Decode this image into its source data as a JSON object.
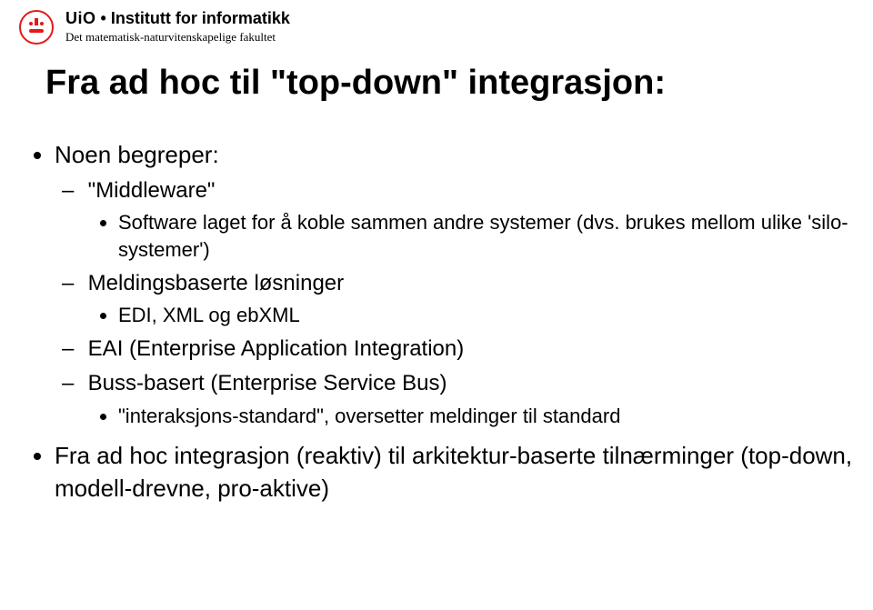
{
  "header": {
    "org": "UiO",
    "sep1": ":",
    "institute": "Institutt for informatikk",
    "faculty": "Det matematisk-naturvitenskapelige fakultet"
  },
  "title": "Fra ad hoc til \"top-down\" integrasjon:",
  "bullets": {
    "b1": "Noen begreper:",
    "b1_1": "\"Middleware\"",
    "b1_1_1": "Software laget for å koble sammen andre systemer (dvs. brukes mellom ulike 'silo-systemer')",
    "b1_2": "Meldingsbaserte løsninger",
    "b1_2_1": "EDI, XML og ebXML",
    "b1_3": "EAI (Enterprise Application Integration)",
    "b1_4": "Buss-basert (Enterprise Service Bus)",
    "b1_4_1": "\"interaksjons-standard\", oversetter meldinger til standard",
    "b2": "Fra ad hoc integrasjon (reaktiv) til arkitektur-baserte tilnærminger (top-down, modell-drevne, pro-aktive)"
  }
}
